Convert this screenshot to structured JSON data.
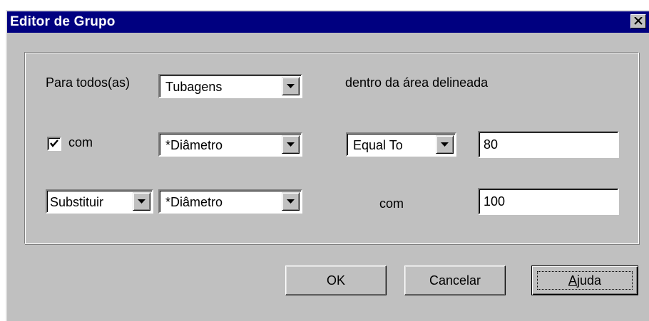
{
  "window": {
    "title": "Editor de Grupo"
  },
  "row1": {
    "label_prefix": "Para todos(as)",
    "object_type": "Tubagens",
    "label_suffix": "dentro da área delineada"
  },
  "row2": {
    "checkbox_checked": true,
    "checkbox_label": "com",
    "property": "*Diâmetro",
    "relation": "Equal To",
    "value": "80"
  },
  "row3": {
    "action": "Substituir",
    "property": "*Diâmetro",
    "label_with": "com",
    "value": "100"
  },
  "buttons": {
    "ok": "OK",
    "cancel": "Cancelar",
    "help_mnemonic": "A",
    "help_rest": "juda"
  },
  "icons": {
    "close": "close-icon",
    "dropdown": "dropdown-arrow-icon",
    "check": "checkmark-icon"
  }
}
